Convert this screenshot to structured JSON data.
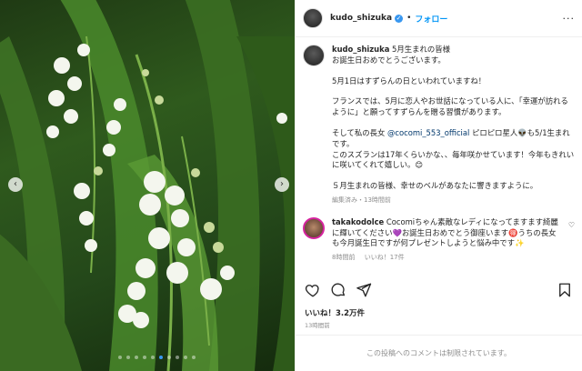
{
  "post": {
    "username": "kudo_shizuka",
    "verified_icon": "verified-badge-icon",
    "separator": "•",
    "follow_label": "フォロー",
    "more_icon": "more-options-icon"
  },
  "photo": {
    "prev_icon": "chevron-left-icon",
    "next_icon": "chevron-right-icon",
    "carousel_count": 10,
    "carousel_active_index": 5
  },
  "caption": {
    "username": "kudo_shizuka",
    "line1": " 5月生まれの皆様",
    "line2": "お誕生日おめでとうございます。",
    "line3": "5月1日はすずらんの日といわれていますね！",
    "line4": "フランスでは、5月に恋人やお世話になっている人に、「幸運が訪れるように」と願ってすずらんを贈る習慣があります。",
    "line5a": "そして私の長女 ",
    "mention": "@cocomi_553_official",
    "line5b": " ピロピロ星人👽も5/1生まれです。",
    "line6": "このスズランは17年くらいかな、、毎年咲かせています！今年もきれいに咲いてくれて嬉しい。😊",
    "line7": "５月生まれの皆様、幸せのベルがあなたに響きますように。",
    "edited": "編集済み・13時間前"
  },
  "comment": {
    "username": "takakodolce",
    "text": " Cocomiちゃん素敵なレディになってますます綺麗に輝いてください💜お誕生日おめでとう御座います🉐うちの長女も今月誕生日ですが何プレゼントしようと悩み中です✨",
    "time": "8時間前",
    "likes": "いいね！17件",
    "heart_icon": "heart-outline-icon"
  },
  "actions": {
    "like_icon": "heart-icon",
    "comment_icon": "comment-icon",
    "share_icon": "share-icon",
    "save_icon": "bookmark-icon"
  },
  "stats": {
    "likes": "いいね！3.2万件",
    "time": "13時間前"
  },
  "footer": {
    "disabled_text": "この投稿へのコメントは制限されています。"
  }
}
